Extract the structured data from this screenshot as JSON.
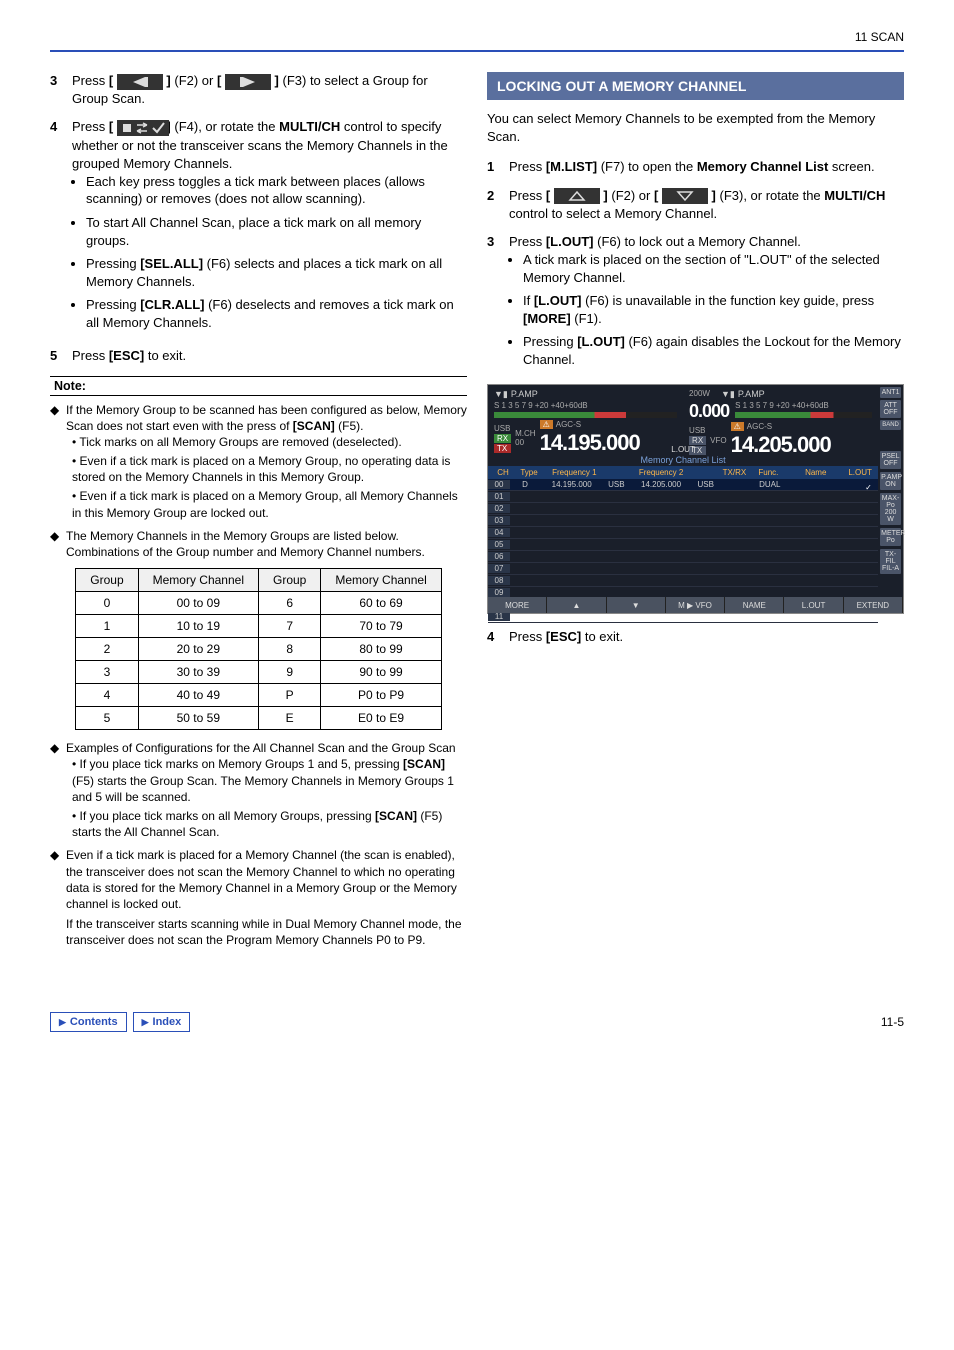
{
  "header": {
    "section": "11 SCAN"
  },
  "left": {
    "step3": {
      "num": "3",
      "t1": "Press ",
      "t2": " (F2) or ",
      "t3": " (F3) to select a Group for Group Scan."
    },
    "step4": {
      "num": "4",
      "t1": "Press ",
      "t2": " (F4), or rotate the ",
      "t3": "MULTI/CH",
      "t4": " control to specify whether or not the transceiver scans the Memory Channels in the grouped Memory Channels.",
      "b1": "Each key press toggles a tick mark between places (allows scanning) or removes (does not allow scanning).",
      "b2": "To start All Channel Scan, place a tick mark on all memory groups.",
      "b3a": "Pressing ",
      "b3b": "[SEL.ALL]",
      "b3c": " (F6) selects and places a tick mark on all Memory Channels.",
      "b4a": "Pressing ",
      "b4b": "[CLR.ALL]",
      "b4c": " (F6) deselects and removes a tick mark on all Memory Channels."
    },
    "step5": {
      "num": "5",
      "t1": "Press ",
      "t2": "[ESC]",
      "t3": " to exit."
    },
    "noteLabel": "Note:",
    "n1": "If the Memory Group to be scanned has been configured as below, Memory Scan does not start even with the press of ",
    "n1b": "[SCAN]",
    "n1c": " (F5).",
    "n1d1": "Tick marks on all Memory Groups are removed (deselected).",
    "n1d2": "Even if a tick mark is placed on a Memory Group, no operating data is stored on the Memory Channels in this Memory Group.",
    "n1d3": "Even if a tick mark is placed on a Memory Group, all Memory Channels in this Memory Group are locked out.",
    "n2": "The Memory Channels in the Memory Groups are listed below. Combinations of the Group number and Memory Channel numbers.",
    "table": {
      "h1": "Group",
      "h2": "Memory Channel",
      "h3": "Group",
      "h4": "Memory Channel",
      "rows": [
        [
          "0",
          "00 to 09",
          "6",
          "60 to 69"
        ],
        [
          "1",
          "10 to 19",
          "7",
          "70 to 79"
        ],
        [
          "2",
          "20 to 29",
          "8",
          "80 to 99"
        ],
        [
          "3",
          "30 to 39",
          "9",
          "90 to 99"
        ],
        [
          "4",
          "40 to 49",
          "P",
          "P0 to P9"
        ],
        [
          "5",
          "50 to 59",
          "E",
          "E0 to E9"
        ]
      ]
    },
    "n3": "Examples of Configurations for the All Channel Scan and the Group Scan",
    "n3d1a": "If you place tick marks on Memory Groups 1 and 5, pressing ",
    "n3d1b": "[SCAN]",
    "n3d1c": " (F5) starts the Group Scan. The Memory Channels in Memory Groups 1 and 5 will be scanned.",
    "n3d2a": "If you place tick marks on all Memory Groups, pressing ",
    "n3d2b": "[SCAN]",
    "n3d2c": " (F5) starts the All Channel Scan.",
    "n4a": "Even if a tick mark is placed for a Memory Channel (the scan is enabled), the transceiver does not scan the Memory Channel to which no operating data is stored for the Memory Channel in a Memory Group or the Memory channel is locked out.",
    "n4b": "If the transceiver starts scanning while in Dual Memory Channel mode, the transceiver does not scan the Program Memory Channels P0 to P9."
  },
  "right": {
    "sectionTitle": "LOCKING OUT A MEMORY CHANNEL",
    "intro": "You can select Memory Channels to be exempted from the Memory Scan.",
    "step1": {
      "num": "1",
      "t1": "Press ",
      "t2": "[M.LIST]",
      "t3": " (F7) to open the ",
      "t4": "Memory Channel List",
      "t5": " screen."
    },
    "step2": {
      "num": "2",
      "t1": "Press ",
      "t2": " (F2) or ",
      "t3": " (F3), or rotate the ",
      "t4": "MULTI/CH",
      "t5": " control to select a Memory Channel."
    },
    "step3": {
      "num": "3",
      "t1": "Press ",
      "t2": "[L.OUT]",
      "t3": " (F6) to lock out a Memory Channel.",
      "b1": "A tick mark is placed on the section of \"L.OUT\" of the selected Memory Channel.",
      "b2a": "If ",
      "b2b": "[L.OUT]",
      "b2c": " (F6) is unavailable in the function key guide, press ",
      "b2d": "[MORE]",
      "b2e": " (F1).",
      "b3a": "Pressing ",
      "b3b": "[L.OUT]",
      "b3c": " (F6) again disables the Lockout for the Memory Channel."
    },
    "radio": {
      "pamp": "P.AMP",
      "ant1": "ANT1",
      "usb": "USB",
      "agcs": "AGC-S",
      "mch": "M.CH",
      "vfo": "VFO",
      "rx": "RX",
      "tx": "TX",
      "freq1": "14.195.000",
      "freq2": "14.205.000",
      "zero": "0.000",
      "pow": "200W",
      "ch00": "00",
      "att": "ATT OFF",
      "psel": "PSEL OFF",
      "pampOn": "P.AMP ON",
      "maxpo": "MAX-Po 200 W",
      "meter": "METER Po",
      "txfil": "TX-FIL FIL-A",
      "band": "BAND",
      "listTitle": "Memory Channel List",
      "lout": "L.OUT",
      "hdr": [
        "CH",
        "Type",
        "Frequency 1",
        "",
        "Frequency 2",
        "",
        "TX/RX",
        "Func.",
        "Name",
        "L.OUT"
      ],
      "row0": [
        "00",
        "D",
        "14.195.000",
        "USB",
        "14.205.000",
        "USB",
        "",
        "DUAL",
        ""
      ],
      "fkeys": [
        "MORE",
        "▲",
        "▼",
        "M ▶ VFO",
        "NAME",
        "L.OUT",
        "EXTEND"
      ]
    },
    "step4": {
      "num": "4",
      "t1": "Press ",
      "t2": "[ESC]",
      "t3": " to exit."
    }
  },
  "footer": {
    "contents": "Contents",
    "index": "Index",
    "page": "11-5"
  }
}
